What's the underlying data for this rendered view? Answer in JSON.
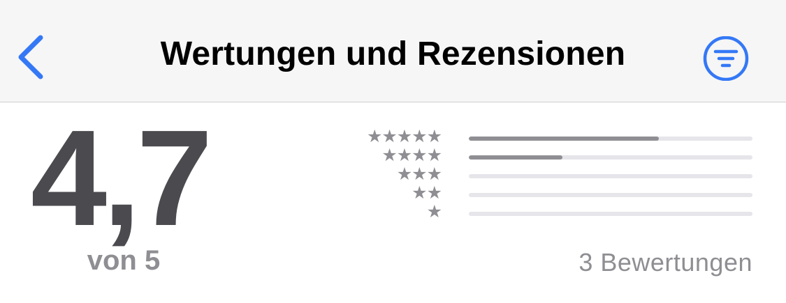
{
  "header": {
    "title": "Wertungen und Rezensionen",
    "back_icon": "chevron-left-icon",
    "filter_icon": "filter-lines-circle-icon",
    "accent_color": "#3478f6"
  },
  "summary": {
    "score": "4,7",
    "out_of": "von 5",
    "rating_count": "3 Bewertungen"
  },
  "distribution": [
    {
      "stars": 5,
      "glyphs": "★★★★★",
      "fraction": 0.67
    },
    {
      "stars": 4,
      "glyphs": "★★★★",
      "fraction": 0.33
    },
    {
      "stars": 3,
      "glyphs": "★★★",
      "fraction": 0
    },
    {
      "stars": 2,
      "glyphs": "★★",
      "fraction": 0
    },
    {
      "stars": 1,
      "glyphs": "★",
      "fraction": 0
    }
  ],
  "colors": {
    "score": "#4a4a4f",
    "secondary": "#8e8e93",
    "track": "#e5e5ea",
    "nav_bg": "#f6f6f6"
  }
}
